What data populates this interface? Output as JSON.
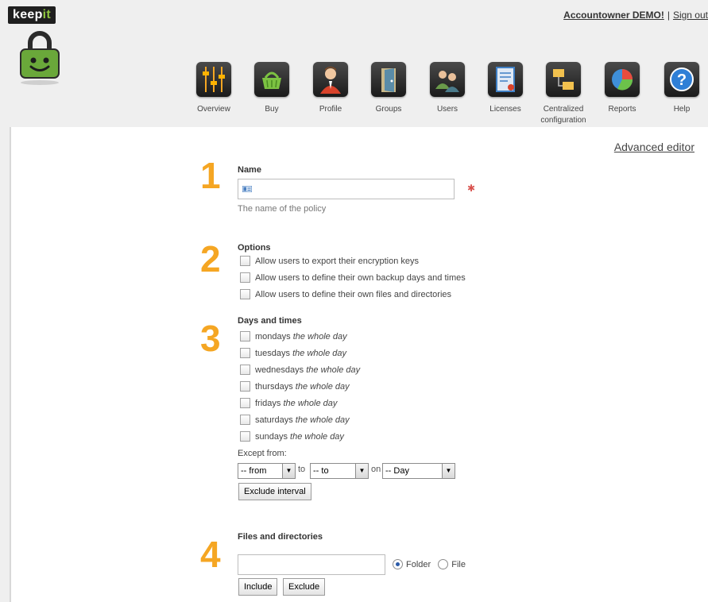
{
  "logo": {
    "text_main": "keep",
    "text_accent": "it"
  },
  "user": {
    "account_link": "Accountowner DEMO!",
    "separator": "|",
    "signout": "Sign out"
  },
  "nav": [
    {
      "label": "Overview",
      "icon": "sliders-icon"
    },
    {
      "label": "Buy",
      "icon": "basket-icon"
    },
    {
      "label": "Profile",
      "icon": "person-icon"
    },
    {
      "label": "Groups",
      "icon": "door-icon"
    },
    {
      "label": "Users",
      "icon": "users-icon"
    },
    {
      "label": "Licenses",
      "icon": "certificate-icon"
    },
    {
      "label_line1": "Centralized",
      "label_line2": "configuration",
      "icon": "folders-icon"
    },
    {
      "label": "Reports",
      "icon": "pie-chart-icon"
    },
    {
      "label": "Help",
      "icon": "help-icon"
    }
  ],
  "advanced_editor": "Advanced editor",
  "step_numbers": [
    "1",
    "2",
    "3",
    "4"
  ],
  "name_section": {
    "title": "Name",
    "value": "",
    "required_marker": "✱",
    "hint": "The name of the policy"
  },
  "options_section": {
    "title": "Options",
    "items": [
      {
        "label": "Allow users to export their encryption keys",
        "checked": false
      },
      {
        "label": "Allow users to define their own backup days and times",
        "checked": false
      },
      {
        "label": "Allow users to define their own files and directories",
        "checked": false
      }
    ]
  },
  "days_section": {
    "title": "Days and times",
    "items": [
      {
        "day": "mondays",
        "range": "the whole day",
        "checked": false
      },
      {
        "day": "tuesdays",
        "range": "the whole day",
        "checked": false
      },
      {
        "day": "wednesdays",
        "range": "the whole day",
        "checked": false
      },
      {
        "day": "thursdays",
        "range": "the whole day",
        "checked": false
      },
      {
        "day": "fridays",
        "range": "the whole day",
        "checked": false
      },
      {
        "day": "saturdays",
        "range": "the whole day",
        "checked": false
      },
      {
        "day": "sundays",
        "range": "the whole day",
        "checked": false
      }
    ],
    "except_label": "Except from:",
    "from_select": "-- from",
    "to_word": "to",
    "to_select": "-- to",
    "on_word": "on",
    "day_select": "-- Day",
    "exclude_interval_button": "Exclude interval"
  },
  "files_section": {
    "title": "Files and directories",
    "path_value": "",
    "radio_folder": "Folder",
    "radio_file": "File",
    "selected": "Folder",
    "include_button": "Include",
    "exclude_button": "Exclude"
  },
  "colors": {
    "accent": "#f5a623",
    "brand_green": "#8fc63f",
    "required": "#d9534f"
  }
}
